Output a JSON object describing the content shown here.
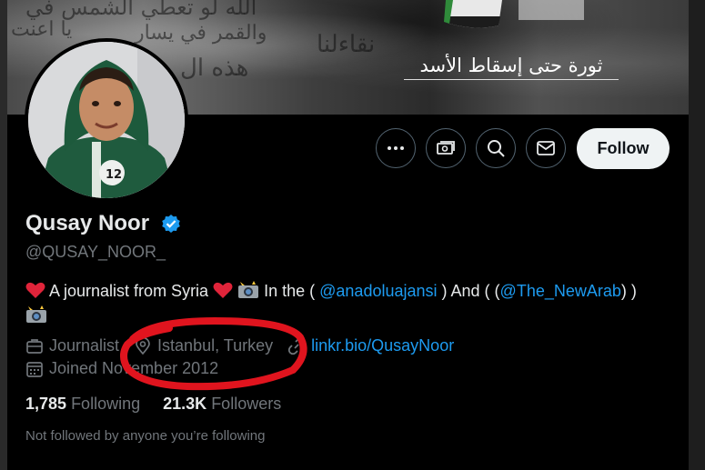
{
  "banner": {
    "slogan": "ثورة حتى إسقاط الأسد",
    "background_text": [
      "الله لو تعطي الشمس في",
      "والقمر في يسار",
      "هذه ال",
      "نقاءلنا",
      "يا اعنت"
    ]
  },
  "profile": {
    "display_name": "Qusay Noor",
    "handle": "@QUSAY_NOOR_",
    "verified": true,
    "bio": {
      "text1": " A journalist from Syria ",
      "text2": " In the ( ",
      "mention1": "@anadoluajansi",
      "text3": " ) And ( (",
      "mention2": "@The_NewArab",
      "text4": ") )"
    },
    "profession": "Journalist",
    "location": "Istanbul, Turkey",
    "website": "linkr.bio/QusayNoor",
    "joined": "Joined November 2012",
    "following_count": "1,785",
    "following_label": "Following",
    "followers_count": "21.3K",
    "followers_label": "Followers",
    "mutual_followers_text": "Not followed by anyone you’re following",
    "avatar_shirt_number": "12"
  },
  "actions": {
    "more_icon": "more-icon",
    "subscribe_icon": "money-icon",
    "search_icon": "search-icon",
    "message_icon": "envelope-icon",
    "follow_label": "Follow"
  },
  "colors": {
    "background": "#000000",
    "link": "#1d9bf0",
    "secondary_text": "#71767b",
    "verified": "#1d9bf0",
    "annotation": "#e0141e"
  }
}
